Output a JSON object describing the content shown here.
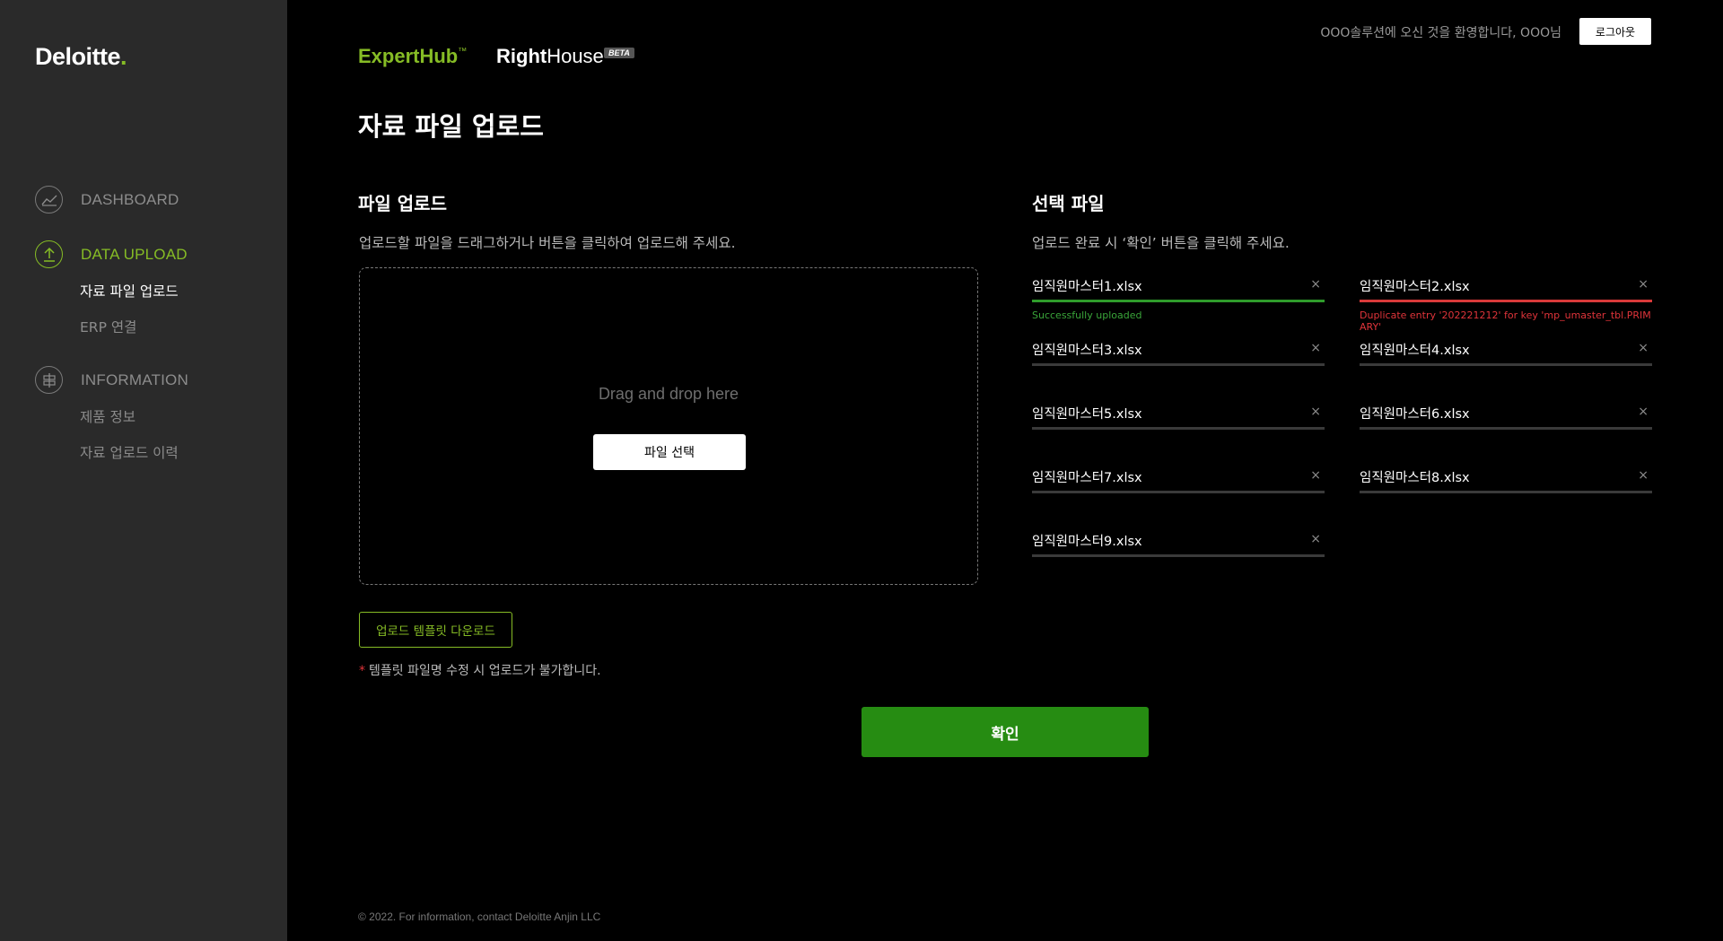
{
  "sidebar": {
    "logo_text": "Deloitte",
    "logo_dot": ".",
    "sections": [
      {
        "label": "DASHBOARD",
        "icon": "chart-line-icon"
      },
      {
        "label": "DATA UPLOAD",
        "icon": "upload-icon"
      },
      {
        "label": "INFORMATION",
        "icon": "signpost-icon"
      }
    ],
    "upload_items": [
      "자료 파일 업로드",
      "ERP 연결"
    ],
    "info_items": [
      "제품 정보",
      "자료 업로드 이력"
    ]
  },
  "header": {
    "brand_expert": "ExpertHub",
    "brand_expert_tm": "™",
    "brand_right_bold": "Right",
    "brand_right_rest": "House",
    "beta": "BETA",
    "welcome": "OOO솔루션에 오신 것을 환영합니다, OOO님",
    "logout": "로그아웃"
  },
  "page_title": "자료 파일 업로드",
  "upload": {
    "title": "파일 업로드",
    "description": "업로드할 파일을 드래그하거나 버튼을 클릭하여 업로드해 주세요.",
    "drop_text": "Drag and drop here",
    "select_button": "파일 선택",
    "template_button": "업로드 템플릿 다운로드",
    "note_star": "*",
    "note": "템플릿 파일명 수정 시 업로드가 불가합니다."
  },
  "selected": {
    "title": "선택 파일",
    "description": "업로드 완료 시 ‘확인’ 버튼을 클릭해 주세요.",
    "close_glyph": "×",
    "files": [
      {
        "name": "임직원마스터1.xlsx",
        "status": "success",
        "message": "Successfully uploaded"
      },
      {
        "name": "임직원마스터2.xlsx",
        "status": "error",
        "message": "Duplicate entry '202221212' for key 'mp_umaster_tbl.PRIMARY'"
      },
      {
        "name": "임직원마스터3.xlsx",
        "status": "pending",
        "message": ""
      },
      {
        "name": "임직원마스터4.xlsx",
        "status": "pending",
        "message": ""
      },
      {
        "name": "임직원마스터5.xlsx",
        "status": "pending",
        "message": ""
      },
      {
        "name": "임직원마스터6.xlsx",
        "status": "pending",
        "message": ""
      },
      {
        "name": "임직원마스터7.xlsx",
        "status": "pending",
        "message": ""
      },
      {
        "name": "임직원마스터8.xlsx",
        "status": "pending",
        "message": ""
      },
      {
        "name": "임직원마스터9.xlsx",
        "status": "pending",
        "message": ""
      }
    ]
  },
  "confirm_button": "확인",
  "footer": "© 2022. For information, contact Deloitte Anjin LLC",
  "colors": {
    "accent": "#86bc25",
    "success": "#2f9c2b",
    "error": "#d93a3a",
    "confirm": "#268c12",
    "sidebar_bg": "#2a2a2a"
  }
}
